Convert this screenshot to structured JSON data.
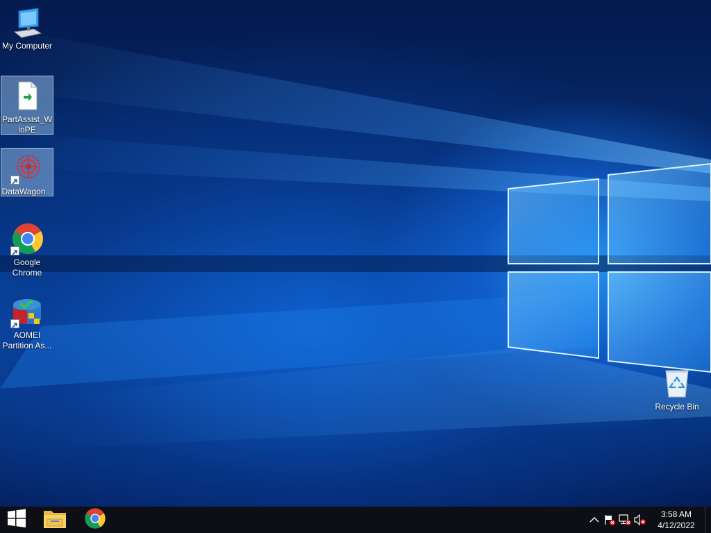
{
  "desktop": {
    "icons": [
      {
        "label": "My Computer",
        "icon": "computer-icon",
        "selected": false
      },
      {
        "label": "PartAssist_WinPE",
        "icon": "file-icon",
        "selected": true
      },
      {
        "label": "DataWagon...",
        "icon": "datawagon-icon",
        "selected": true
      },
      {
        "label": "Google Chrome",
        "icon": "chrome-icon",
        "selected": false
      },
      {
        "label": "AOMEI Partition As...",
        "icon": "aomei-icon",
        "selected": false
      },
      {
        "label": "Recycle Bin",
        "icon": "recycle-bin-icon",
        "selected": false
      }
    ]
  },
  "taskbar": {
    "buttons": [
      {
        "name": "start",
        "icon": "windows-logo-icon"
      },
      {
        "name": "file-explorer",
        "icon": "folder-icon"
      },
      {
        "name": "chrome",
        "icon": "chrome-icon"
      }
    ],
    "tray": {
      "icons": [
        "chevron-up-icon",
        "action-center-flag-icon",
        "network-icon",
        "volume-muted-icon"
      ],
      "time": "3:58 AM",
      "date": "4/12/2022"
    }
  },
  "colors": {
    "taskbar": "#0d0f14",
    "wallpaper_accent": "#1e8cff",
    "selection": "#8cb4dc"
  }
}
